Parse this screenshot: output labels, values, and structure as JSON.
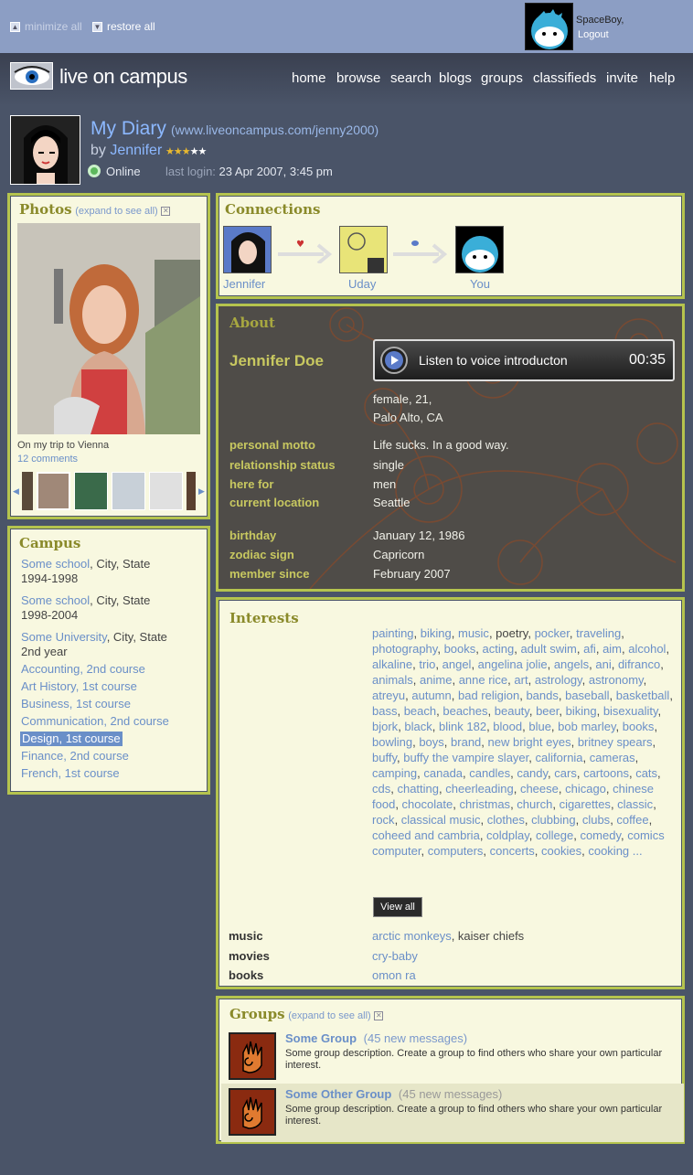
{
  "topbar": {
    "minimize_label": "minimize all",
    "restore_label": "restore all",
    "user_name": "SpaceBoy,",
    "logout_label": "Logout"
  },
  "nav": {
    "logo_text": "live on campus",
    "items": [
      "home",
      "browse",
      "search",
      "blogs",
      "groups",
      "classifieds",
      "invite",
      "help"
    ]
  },
  "profile": {
    "title": "My Diary",
    "url": "(www.liveoncampus.com/jenny2000)",
    "by_prefix": "by",
    "author": "Jennifer",
    "rating": 3,
    "rating_max": 5,
    "status": "Online",
    "last_login_label": "last login:",
    "last_login_value": "23 Apr 2007, 3:45 pm"
  },
  "photos": {
    "title": "Photos",
    "expand_label": "(expand to see all)",
    "caption": "On my trip to Vienna",
    "comments": "12 comments"
  },
  "connections": {
    "title": "Connections",
    "people": [
      "Jennifer",
      "Uday",
      "You"
    ]
  },
  "about": {
    "title": "About",
    "name": "Jennifer Doe",
    "voice_label": "Listen to voice introducton",
    "voice_time": "00:35",
    "basic_line1": "female, 21,",
    "basic_line2": "Palo Alto, CA",
    "fields": [
      {
        "label": "personal motto",
        "value": "Life sucks. In a good way."
      },
      {
        "label": "relationship status",
        "value": "single"
      },
      {
        "label": "here for",
        "value": "men"
      },
      {
        "label": "current location",
        "value": "Seattle"
      },
      {
        "label": "birthday",
        "value": "January 12, 1986"
      },
      {
        "label": "zodiac sign",
        "value": "Capricorn"
      },
      {
        "label": "member since",
        "value": "February 2007"
      }
    ]
  },
  "campus": {
    "title": "Campus",
    "schools": [
      {
        "name": "Some school",
        "loc": ", City, State",
        "years": "1994-1998"
      },
      {
        "name": "Some school",
        "loc": ", City, State",
        "years": "1998-2004"
      },
      {
        "name": "Some University",
        "loc": ", City, State",
        "years": "2nd year"
      }
    ],
    "courses": [
      "Accounting, 2nd course",
      "Art History, 1st course",
      "Business, 1st course",
      "Communication, 2nd course",
      "Design, 1st course",
      "Finance, 2nd course",
      "French, 1st course"
    ],
    "selected_course": "Design, 1st course"
  },
  "interests": {
    "title": "Interests",
    "tags": [
      "painting",
      "biking",
      "music",
      "poetry",
      "pocker",
      "traveling",
      "photography",
      "books",
      "acting",
      "adult swim",
      "afi",
      "aim",
      "alcohol",
      "alkaline",
      "trio",
      "angel",
      "angelina jolie",
      "angels",
      "ani",
      "difranco",
      "animals",
      "anime",
      "anne rice",
      "art",
      "astrology",
      "astronomy",
      "atreyu",
      "autumn",
      "bad religion",
      "bands",
      "baseball",
      "basketball",
      "bass",
      "beach",
      "beaches",
      "beauty",
      "beer",
      "biking",
      "bisexuality",
      "bjork",
      "black",
      "blink 182",
      "blood",
      "blue",
      "bob marley",
      "books",
      "bowling",
      "boys",
      "brand",
      "new bright eyes",
      "britney spears",
      "buffy",
      "buffy the vampire slayer",
      "california",
      "cameras",
      "camping",
      "canada",
      "candles",
      "candy",
      "cars",
      "cartoons",
      "cats",
      "cds",
      "chatting",
      "cheerleading",
      "cheese",
      "chicago",
      "chinese food",
      "chocolate",
      "christmas",
      "church",
      "cigarettes",
      "classic",
      "rock",
      "classical music",
      "clothes",
      "clubbing",
      "clubs",
      "coffee",
      "coheed and cambria",
      "coldplay",
      "college",
      "comedy",
      "comics computer",
      "computers",
      "concerts",
      "cookies",
      "cooking ..."
    ],
    "plain_tags": [
      "poetry"
    ],
    "view_all_label": "View  all",
    "music_label": "music",
    "music_link": "arctic monkeys",
    "music_rest": ", kaiser chiefs",
    "movies_label": "movies",
    "movies_value": "cry-baby",
    "books_label": "books",
    "books_value": "omon ra"
  },
  "groups": {
    "title": "Groups",
    "expand_label": "(expand to see all)",
    "items": [
      {
        "name": "Some Group",
        "messages": "(45 new messages)",
        "desc": "Some group description. Create a group to find others who share your own particular interest."
      },
      {
        "name": "Some Other Group",
        "messages": "(45 new messages)",
        "desc": "Some group description. Create a group to find others who share your own particular interest."
      }
    ]
  },
  "colors": {
    "accent": "#b5c44e",
    "link": "#6a8fc8",
    "background": "#4a5468"
  }
}
